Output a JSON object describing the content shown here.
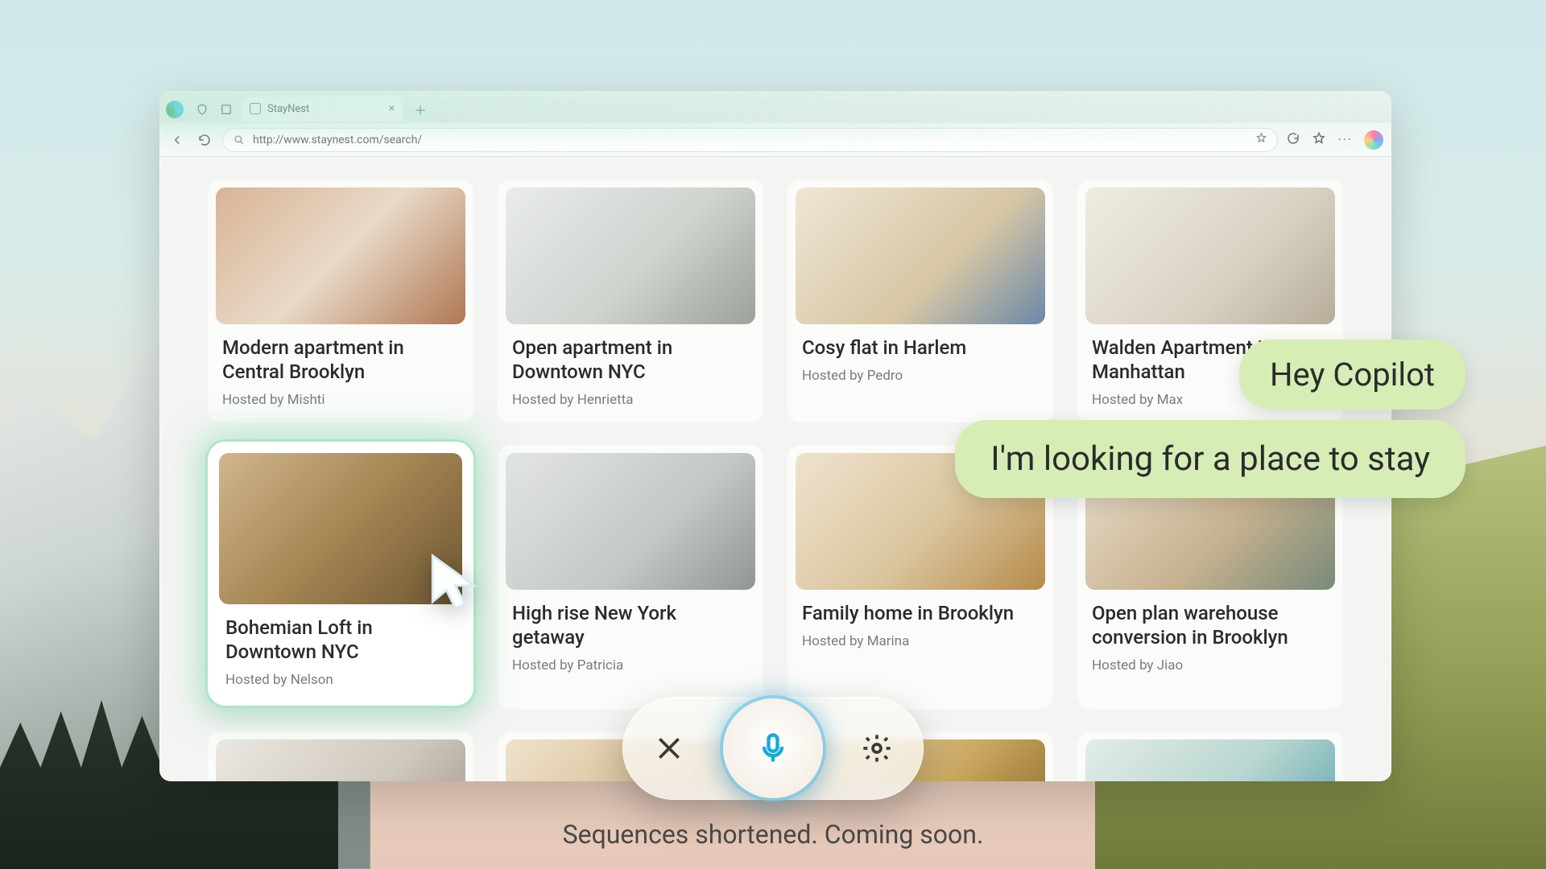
{
  "browser": {
    "tab_title": "StayNest",
    "url": "http://www.staynest.com/search/"
  },
  "listings": [
    {
      "title": "Modern apartment in Central Brooklyn",
      "host": "Hosted by Mishti",
      "img": "th-a"
    },
    {
      "title": "Open apartment in Downtown NYC",
      "host": "Hosted by Henrietta",
      "img": "th-b"
    },
    {
      "title": "Cosy flat in Harlem",
      "host": "Hosted by Pedro",
      "img": "th-c"
    },
    {
      "title": "Walden Apartment in Manhattan",
      "host": "Hosted by Max",
      "img": "th-d"
    },
    {
      "title": "Bohemian Loft in Downtown NYC",
      "host": "Hosted by Nelson",
      "img": "th-e",
      "highlight": true
    },
    {
      "title": "High rise New York getaway",
      "host": "Hosted by Patricia",
      "img": "th-f"
    },
    {
      "title": "Family home in Brooklyn",
      "host": "Hosted by Marina",
      "img": "th-g"
    },
    {
      "title": "Open plan warehouse conversion in Brooklyn",
      "host": "Hosted by Jiao",
      "img": "th-h"
    },
    {
      "title": "",
      "host": "",
      "img": "th-i",
      "partial": true
    },
    {
      "title": "",
      "host": "",
      "img": "th-j",
      "partial": true
    },
    {
      "title": "",
      "host": "",
      "img": "th-k",
      "partial": true
    },
    {
      "title": "",
      "host": "",
      "img": "th-l",
      "partial": true
    }
  ],
  "chat": {
    "bubble1": "Hey Copilot",
    "bubble2": "I'm looking for a place to stay"
  },
  "caption": "Sequences shortened. Coming soon."
}
